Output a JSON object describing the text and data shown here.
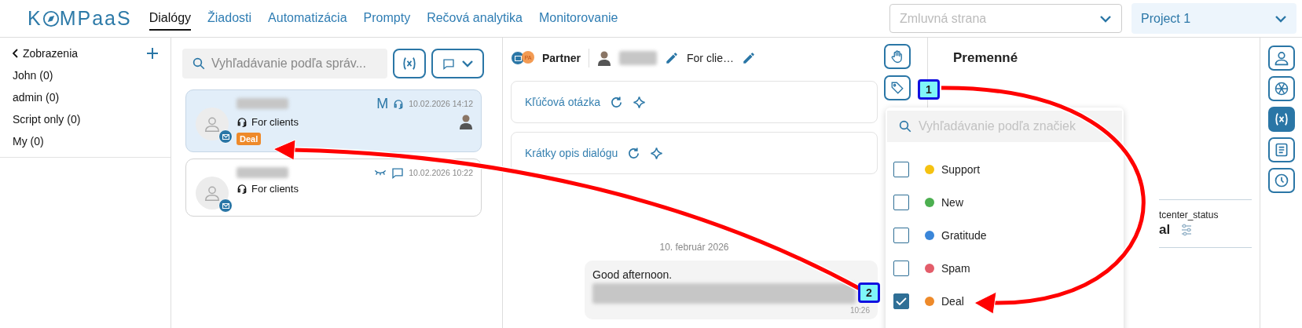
{
  "header": {
    "logo_start": "K",
    "logo_end": "MPaaS",
    "tabs": [
      {
        "label": "Dialógy",
        "selected": true
      },
      {
        "label": "Žiadosti",
        "selected": false
      },
      {
        "label": "Automatizácia",
        "selected": false
      },
      {
        "label": "Prompty",
        "selected": false
      },
      {
        "label": "Rečová analytika",
        "selected": false
      },
      {
        "label": "Monitorovanie",
        "selected": false
      }
    ],
    "contract_select": {
      "placeholder": "Zmluvná strana"
    },
    "project_select": {
      "value": "Project 1"
    }
  },
  "sidebar": {
    "title": "Zobrazenia",
    "items": [
      {
        "label": "John (0)"
      },
      {
        "label": "admin (0)"
      },
      {
        "label": "Script only (0)"
      },
      {
        "label": "My (0)"
      }
    ]
  },
  "dialog_list": {
    "search": {
      "placeholder": "Vyhľadávanie podľa správ..."
    },
    "dialogs": [
      {
        "selected": true,
        "channel_mark": "M",
        "status_icons": [
          {
            "kind": "headset"
          }
        ],
        "date": "10.02.2026 14:12",
        "queue": "For clients",
        "tag": {
          "label": "Deal",
          "color": "#ee8a2a"
        },
        "agent_avatar": true
      },
      {
        "selected": false,
        "status_icons": [
          {
            "kind": "closed-eye"
          },
          {
            "kind": "chat"
          }
        ],
        "date": "10.02.2026 10:22",
        "queue": "For clients",
        "agent_avatar": false
      }
    ]
  },
  "chat": {
    "channel_initials": "PA",
    "partner": "Partner",
    "queue": "For clie…",
    "cards": [
      {
        "label": "Kľúčová otázka"
      },
      {
        "label": "Krátky opis dialógu"
      }
    ],
    "date": "10. február 2026",
    "message": {
      "text": "Good afternoon.",
      "time": "10:26"
    }
  },
  "variables": {
    "title": "Premenné",
    "variable_name": "tcenter_status",
    "variable_value": "al"
  },
  "tag_menu": {
    "search": {
      "placeholder": "Vyhľadávanie podľa značiek"
    },
    "tags": [
      {
        "label": "Support",
        "color": "#f5c211",
        "checked": false
      },
      {
        "label": "New",
        "color": "#4caf50",
        "checked": false
      },
      {
        "label": "Gratitude",
        "color": "#3a86d9",
        "checked": false
      },
      {
        "label": "Spam",
        "color": "#e35d6a",
        "checked": false
      },
      {
        "label": "Deal",
        "color": "#ee8a2a",
        "checked": true
      }
    ]
  },
  "right_bar": {
    "items": [
      {
        "kind": "person",
        "selected": false
      },
      {
        "kind": "ai",
        "selected": false
      },
      {
        "kind": "variable",
        "selected": true
      },
      {
        "kind": "document",
        "selected": false
      },
      {
        "kind": "history",
        "selected": false
      }
    ]
  },
  "annotations": {
    "markers": [
      "1",
      "2"
    ]
  }
}
